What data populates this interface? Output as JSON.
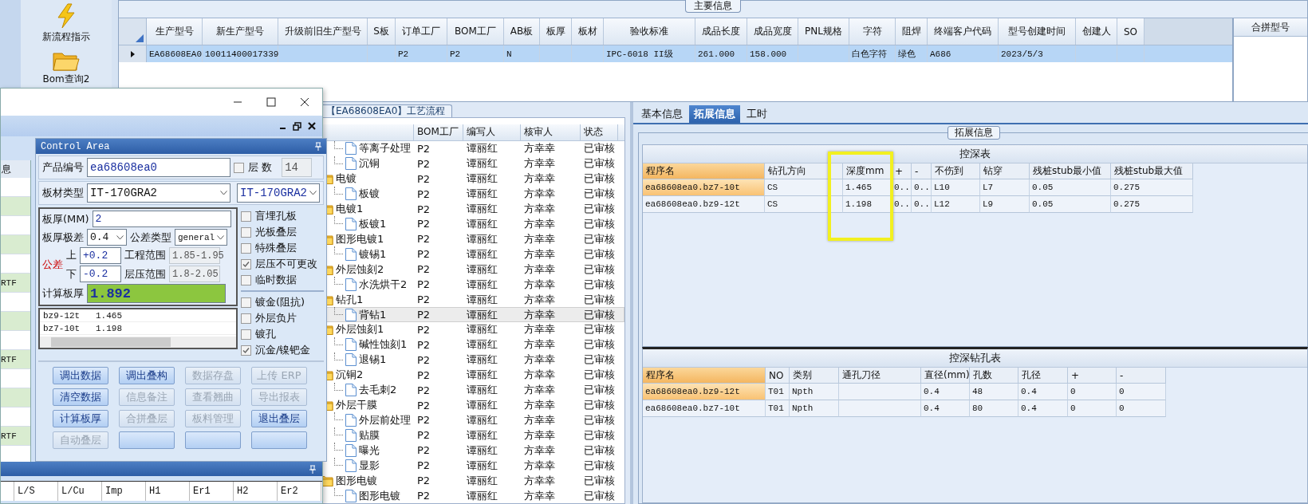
{
  "launcher": {
    "items": [
      {
        "label": "新流程指示",
        "kind": "bolt"
      },
      {
        "label": "Bom查询2",
        "kind": "folder"
      }
    ]
  },
  "main_info": {
    "title": "主要信息",
    "side_title": "合拼型号",
    "columns": [
      "生产型号",
      "新生产型号",
      "升级前旧生产型号",
      "S板",
      "订单工厂",
      "BOM工厂",
      "AB板",
      "板厚",
      "板材",
      "验收标准",
      "成品长度",
      "成品宽度",
      "PNL规格",
      "字符",
      "阻焊",
      "终端客户代码",
      "型号创建时间",
      "创建人",
      "SO"
    ],
    "rows": [
      {
        "selected": true,
        "cells": [
          "EA68608EA0",
          "10011400017339",
          "",
          "",
          "P2",
          "P2",
          "N",
          "",
          "",
          "IPC-6018 II级",
          "261.000",
          "158.000",
          "",
          "白色字符",
          "绿色",
          "A686",
          "2023/5/3",
          "",
          ""
        ]
      }
    ]
  },
  "process_flow": {
    "tab": "【EA68608EA0】工艺流程",
    "columns": [
      "BOM工厂",
      "编写人",
      "核审人",
      "状态"
    ],
    "tree": [
      {
        "children": [
          {
            "name": "等离子处理",
            "factory": "P2",
            "writer": "谭丽红",
            "reviewer": "方幸幸",
            "status": "已审核",
            "selected": false
          },
          {
            "name": "沉铜",
            "factory": "P2",
            "writer": "谭丽红",
            "reviewer": "方幸幸",
            "status": "已审核",
            "selected": false
          }
        ]
      },
      {
        "name": "电镀",
        "factory": "P2",
        "writer": "谭丽红",
        "reviewer": "方幸幸",
        "status": "已审核",
        "selected": false,
        "children": [
          {
            "name": "板镀",
            "factory": "P2",
            "writer": "谭丽红",
            "reviewer": "方幸幸",
            "status": "已审核",
            "selected": false
          }
        ]
      },
      {
        "name": "电镀1",
        "factory": "P2",
        "writer": "谭丽红",
        "reviewer": "方幸幸",
        "status": "已审核",
        "selected": false,
        "children": [
          {
            "name": "板镀1",
            "factory": "P2",
            "writer": "谭丽红",
            "reviewer": "方幸幸",
            "status": "已审核",
            "selected": false
          }
        ]
      },
      {
        "name": "图形电镀1",
        "factory": "P2",
        "writer": "谭丽红",
        "reviewer": "方幸幸",
        "status": "已审核",
        "selected": false,
        "children": [
          {
            "name": "镀锡1",
            "factory": "P2",
            "writer": "谭丽红",
            "reviewer": "方幸幸",
            "status": "已审核",
            "selected": false
          }
        ]
      },
      {
        "name": "外层蚀刻2",
        "factory": "P2",
        "writer": "谭丽红",
        "reviewer": "方幸幸",
        "status": "已审核",
        "selected": false,
        "children": [
          {
            "name": "水洗烘干2",
            "factory": "P2",
            "writer": "谭丽红",
            "reviewer": "方幸幸",
            "status": "已审核",
            "selected": false
          }
        ]
      },
      {
        "name": "钻孔1",
        "factory": "P2",
        "writer": "谭丽红",
        "reviewer": "方幸幸",
        "status": "已审核",
        "selected": false,
        "children": [
          {
            "name": "背钻1",
            "factory": "P2",
            "writer": "谭丽红",
            "reviewer": "方幸幸",
            "status": "已审核",
            "selected": true
          }
        ]
      },
      {
        "name": "外层蚀刻1",
        "factory": "P2",
        "writer": "谭丽红",
        "reviewer": "方幸幸",
        "status": "已审核",
        "selected": false,
        "children": [
          {
            "name": "碱性蚀刻1",
            "factory": "P2",
            "writer": "谭丽红",
            "reviewer": "方幸幸",
            "status": "已审核",
            "selected": false
          },
          {
            "name": "退锡1",
            "factory": "P2",
            "writer": "谭丽红",
            "reviewer": "方幸幸",
            "status": "已审核",
            "selected": false
          }
        ]
      },
      {
        "name": "沉铜2",
        "factory": "P2",
        "writer": "谭丽红",
        "reviewer": "方幸幸",
        "status": "已审核",
        "selected": false,
        "children": [
          {
            "name": "去毛刺2",
            "factory": "P2",
            "writer": "谭丽红",
            "reviewer": "方幸幸",
            "status": "已审核",
            "selected": false
          }
        ]
      },
      {
        "name": "外层干膜",
        "factory": "P2",
        "writer": "谭丽红",
        "reviewer": "方幸幸",
        "status": "已审核",
        "selected": false,
        "children": [
          {
            "name": "外层前处理",
            "factory": "P2",
            "writer": "谭丽红",
            "reviewer": "方幸幸",
            "status": "已审核",
            "selected": false
          },
          {
            "name": "贴膜",
            "factory": "P2",
            "writer": "谭丽红",
            "reviewer": "方幸幸",
            "status": "已审核",
            "selected": false
          },
          {
            "name": "曝光",
            "factory": "P2",
            "writer": "谭丽红",
            "reviewer": "方幸幸",
            "status": "已审核",
            "selected": false
          },
          {
            "name": "显影",
            "factory": "P2",
            "writer": "谭丽红",
            "reviewer": "方幸幸",
            "status": "已审核",
            "selected": false
          }
        ]
      },
      {
        "name": "图形电镀",
        "factory": "P2",
        "writer": "谭丽红",
        "reviewer": "方幸幸",
        "status": "已审核",
        "selected": false,
        "children": [
          {
            "name": "图形电镀",
            "factory": "P2",
            "writer": "谭丽红",
            "reviewer": "方幸幸",
            "status": "已审核",
            "selected": false
          }
        ]
      }
    ]
  },
  "details": {
    "tabs": [
      {
        "label": "基本信息",
        "selected": false
      },
      {
        "label": "拓展信息",
        "selected": true
      },
      {
        "label": "工时",
        "selected": false
      }
    ],
    "group_title": "拓展信息",
    "depth_table": {
      "title": "控深表",
      "columns": [
        "程序名",
        "钻孔方向",
        "深度mm",
        "+",
        "-",
        "不伤到",
        "钻穿",
        "残桩stub最小值",
        "残桩stub最大值"
      ],
      "rows": [
        {
          "selected": true,
          "cells": [
            "ea68608ea0.bz7-10t",
            "CS",
            "1.465",
            "0..",
            "0..",
            "L10",
            "L7",
            "0.05",
            "0.275"
          ]
        },
        {
          "selected": false,
          "cells": [
            "ea68608ea0.bz9-12t",
            "CS",
            "1.198",
            "0..",
            "0..",
            "L12",
            "L9",
            "0.05",
            "0.275"
          ]
        }
      ]
    },
    "drill_table": {
      "title": "控深钻孔表",
      "columns": [
        "程序名",
        "NO",
        "类别",
        "通孔刀径",
        "直径(mm)",
        "孔数",
        "孔径",
        "+",
        "-"
      ],
      "rows": [
        {
          "selected": true,
          "cells": [
            "ea68608ea0.bz9-12t",
            "T01",
            "Npth",
            "",
            "0.4",
            "48",
            "0.4",
            "0",
            "0"
          ]
        },
        {
          "selected": false,
          "cells": [
            "ea68608ea0.bz7-10t",
            "T01",
            "Npth",
            "",
            "0.4",
            "80",
            "0.4",
            "0",
            "0"
          ]
        }
      ]
    }
  },
  "dialog": {
    "side_list": {
      "header": "息",
      "rows": [
        {
          "shaded": false
        },
        {
          "shaded": true
        },
        {
          "shaded": false
        },
        {
          "shaded": true
        },
        {
          "shaded": false
        },
        {
          "shaded": true,
          "text": "RTF"
        },
        {
          "shaded": false
        },
        {
          "shaded": true
        },
        {
          "shaded": false
        },
        {
          "shaded": true,
          "text": "RTF"
        },
        {
          "shaded": false
        },
        {
          "shaded": true
        },
        {
          "shaded": false
        },
        {
          "shaded": true,
          "text": "RTF"
        }
      ]
    },
    "control_area": {
      "title": "Control Area",
      "product_no": {
        "label": "产品编号",
        "value": "ea68608ea0"
      },
      "layers": {
        "label": "层 数",
        "checked": false,
        "value": "14"
      },
      "material": {
        "label": "板材类型",
        "value": "IT-170GRA2",
        "value_2": "IT-170GRA2"
      },
      "thickness": {
        "label": "板厚(MM)",
        "value": "2"
      },
      "range": {
        "label": "板厚极差",
        "value": "0.4"
      },
      "tolerance_type": {
        "label": "公差类型",
        "value": "general"
      },
      "tolerance": {
        "label": "公差",
        "upper_label": "上",
        "upper": "+0.2",
        "lower_label": "下",
        "lower": "-0.2"
      },
      "eng_range": {
        "label": "工程范围",
        "value": "1.85-1.95"
      },
      "press_range": {
        "label": "层压范围",
        "value": "1.8-2.05"
      },
      "calc": {
        "label": "计算板厚",
        "value": "1.892"
      },
      "depth_list": [
        {
          "name": "bz9-12t",
          "value": "1.465"
        },
        {
          "name": "bz7-10t",
          "value": "1.198"
        }
      ],
      "options": [
        {
          "label": "盲埋孔板",
          "checked": false
        },
        {
          "label": "光板叠层",
          "checked": false
        },
        {
          "label": "特殊叠层",
          "checked": false
        },
        {
          "label": "层压不可更改",
          "checked": true
        },
        {
          "label": "临时数据",
          "checked": false
        }
      ],
      "options_2": [
        {
          "label": "镀金(阻抗)",
          "checked": false
        },
        {
          "label": "外层负片",
          "checked": false
        },
        {
          "label": "镀孔",
          "checked": false
        },
        {
          "label": "沉金/镍钯金",
          "checked": true
        }
      ],
      "buttons": [
        {
          "label": "调出数据",
          "disabled": false
        },
        {
          "label": "调出叠构",
          "disabled": false
        },
        {
          "label": "数据存盘",
          "disabled": true
        },
        {
          "label": "上传 ERP",
          "disabled": true
        },
        {
          "label": "清空数据",
          "disabled": false
        },
        {
          "label": "信息备注",
          "disabled": true
        },
        {
          "label": "查看翘曲",
          "disabled": true
        },
        {
          "label": "导出报表",
          "disabled": true
        },
        {
          "label": "计算板厚",
          "disabled": false
        },
        {
          "label": "合拼叠层",
          "disabled": true
        },
        {
          "label": "板料管理",
          "disabled": true
        },
        {
          "label": "退出叠层",
          "disabled": false
        },
        {
          "label": "自动叠层",
          "disabled": true
        },
        {
          "disabled": false
        },
        {
          "disabled": false
        },
        {
          "disabled": false
        }
      ]
    },
    "bottom_table": {
      "columns": [
        "L/S",
        "L/Cu",
        "Imp",
        "H1",
        "Er1",
        "H2",
        "Er2"
      ]
    }
  }
}
